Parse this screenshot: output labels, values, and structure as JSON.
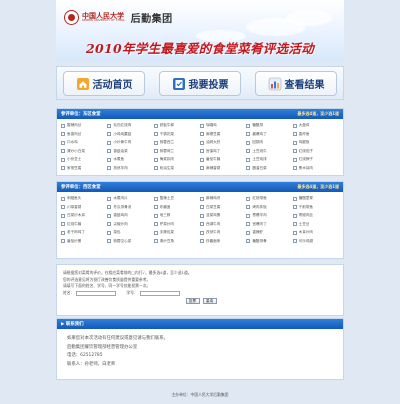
{
  "header": {
    "university_cn": "中国人民大学",
    "university_en": "RENMIN UNIVERSITY OF CHINA",
    "group_name": "后勤集团",
    "event_title": "2010年学生最喜爱的食堂菜肴评选活动"
  },
  "nav": [
    {
      "label": "活动首页",
      "icon": "home-icon"
    },
    {
      "label": "我要投票",
      "icon": "ballot-icon"
    },
    {
      "label": "查看结果",
      "icon": "bar-chart-icon"
    }
  ],
  "east": {
    "title": "参评单位：东区食堂",
    "meta": "最多选4道，至少选1道",
    "items": [
      "酸辣肉丝",
      "毛氏红烧肉",
      "铁板牛柳",
      "咖喱鸡",
      "糖醋排",
      "大盘鸡",
      "鱼香肉丝",
      "小鸡炖蘑菇",
      "干锅花菜",
      "麻婆豆腐",
      "酱爆鸡丁",
      "香炸鱼",
      "口水鸡",
      "小炒黄牛肉",
      "蒜蓉西兰",
      "油焖大虾",
      "回锅肉",
      "鸡腿饭",
      "清炒小白菜",
      "香菇油菜",
      "蒜蓉荷兰",
      "宫保鸡丁",
      "土豆烧牛",
      "红烧茄子",
      "小份芝士",
      "水煮鱼",
      "梅菜扣肉",
      "番茄牛腩",
      "土豆炖排",
      "红烧狮子",
      "家常豆腐",
      "孜然羊肉",
      "蚝油生菜",
      "麻辣香锅",
      "醋溜白菜",
      "黑木耳肉"
    ]
  },
  "west": {
    "title": "参评单位：西区食堂",
    "meta": "最多选4道，至少选1道",
    "items": [
      "剁椒鱼头",
      "水煮肉片",
      "酸辣土豆",
      "麻辣鸡块",
      "红烧带鱼",
      "糖醋里脊",
      "川味香锅",
      "冬瓜排骨汤",
      "炸酱面",
      "白菜豆腐",
      "烤肉拌饭",
      "干煎带鱼",
      "白菜炒木耳",
      "香菇鸡肉",
      "地三鲜",
      "韭菜鸡蛋",
      "葱爆羊肉",
      "青椒肉丝",
      "红烧牛腩",
      "尖椒炒肉",
      "芹菜炒肉",
      "西湖牛肉",
      "宫爆肉丁",
      "土豆丝",
      "老干妈鸡丁",
      "菜包",
      "手撕包菜",
      "孜然牛肉",
      "香辣虾",
      "木耳炒肉",
      "番茄炒蛋",
      "蒜蓉空心菜",
      "清炒豆角",
      "炸酱面条",
      "糖醋排骨",
      "可乐鸡翅"
    ]
  },
  "form": {
    "line1": "请根据您对菜肴的评价，在相应菜肴前的□内打√，最多选4道，至少选1道。",
    "line2": "您的评选意见将为餐厅改善饮食质量提供重要参考。",
    "line3": "请填写下面的姓名、学号，同一学号仅能投票一次。",
    "name_label": "姓名：",
    "id_label": "学号：",
    "submit": "投票",
    "reset": "重填"
  },
  "contact": {
    "title": "▶ 联系我们",
    "lines": [
      "如果您对本次活动有任何建议或意见请与我们联系。",
      "后勤集团餐饮管理部经营管理办公室",
      "电话：62512785",
      "联系人：孙老师，白老师"
    ]
  },
  "footer": "主办单位：中国人民大学后勤集团",
  "colors": {
    "section_header": "#1a64c4",
    "title_red": "#c4161c",
    "nav_text": "#1d3f7a"
  }
}
